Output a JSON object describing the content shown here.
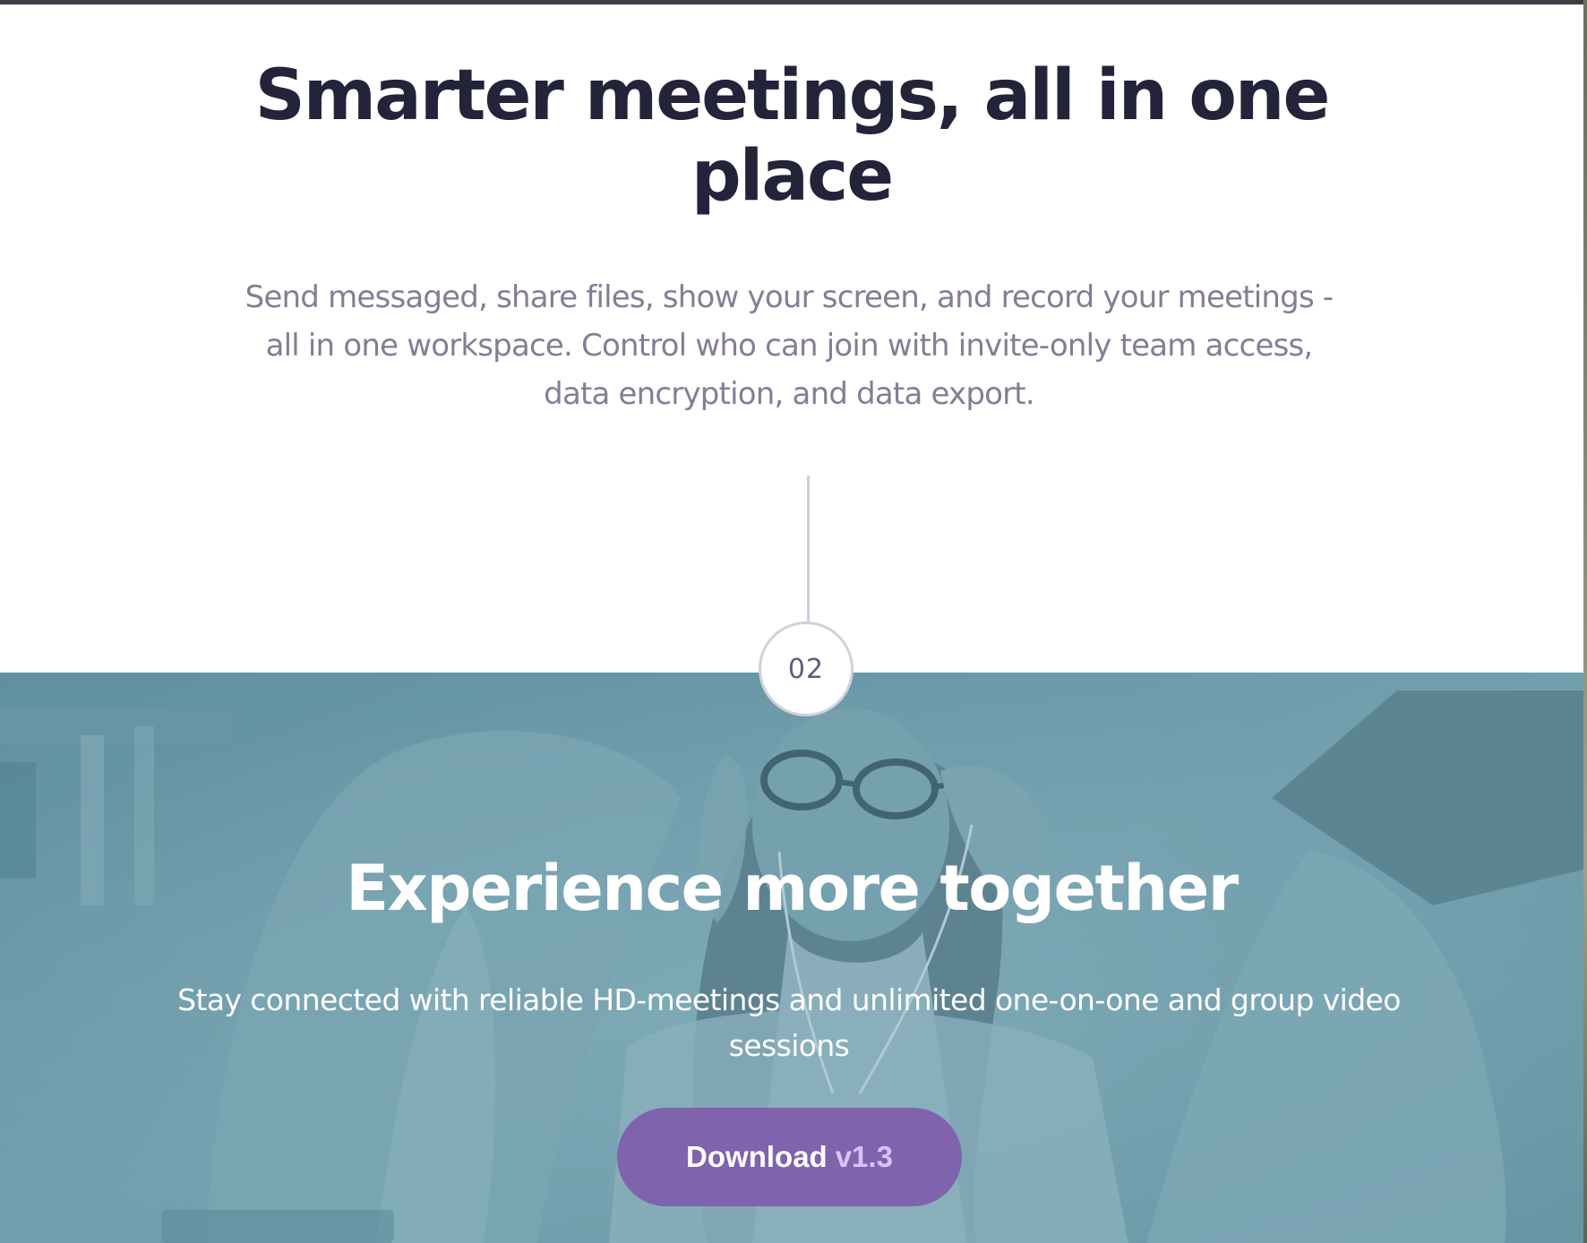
{
  "hero": {
    "title_line1": "Smarter meetings, all in one",
    "title_line2": "place",
    "description": "Send messaged, share files, show your screen, and record your meetings - all in one workspace. Control who can join with invite-only team access, data encryption, and data export."
  },
  "step": {
    "number": "02"
  },
  "cta": {
    "title": "Experience more together",
    "description": "Stay connected with reliable HD-meetings and unlimited one-on-one and group video sessions",
    "button_label": "Download",
    "button_version": "v1.3"
  },
  "colors": {
    "heading": "#23233a",
    "body_text": "#807f96",
    "photo_tint": "#6d9aa8",
    "button_bg": "#7f63ad",
    "button_version": "#d9c3ff"
  },
  "icons": {
    "background_image": "woman-with-headphones-photo"
  }
}
